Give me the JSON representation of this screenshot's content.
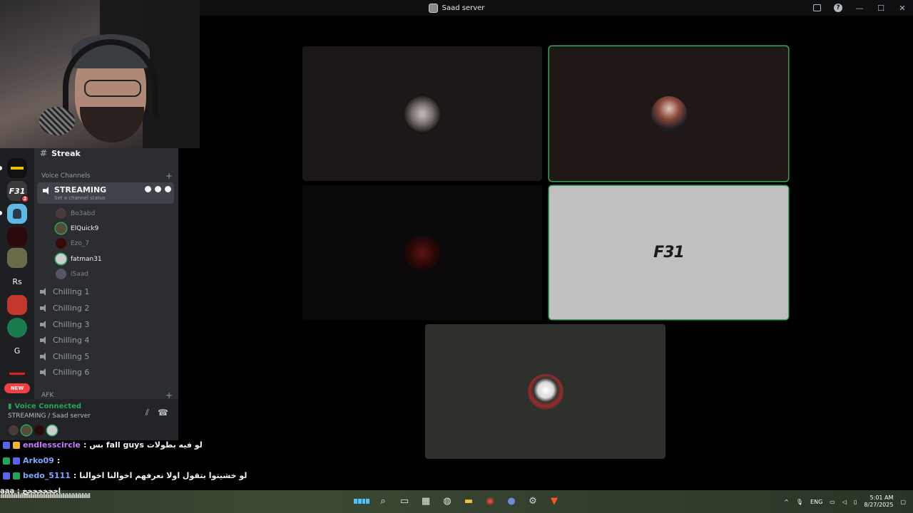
{
  "window": {
    "title": "Saad server"
  },
  "sidebar": {
    "text_channel": "Streak",
    "voice_category": "Voice Channels",
    "active_channel": {
      "name": "STREAMING",
      "status": "Set a channel status"
    },
    "users": [
      "Bo3abd",
      "ElQuick9",
      "Ezo_7",
      "fatman31",
      "iSaad"
    ],
    "channels": [
      "Chilling 1",
      "Chilling 2",
      "Chilling 3",
      "Chilling 4",
      "Chilling 5",
      "Chilling 6"
    ],
    "afk_category": "AFK"
  },
  "servers": {
    "f31_label": "F31",
    "f31_badge": "1",
    "rs_label": "Rs",
    "g_label": "G",
    "new_badge": "NEW"
  },
  "voice_panel": {
    "status": "Voice Connected",
    "location": "STREAMING / Saad server"
  },
  "stage": {
    "tile4_label": "F31"
  },
  "chat": [
    {
      "name": "endlesscircle",
      "sep": ":",
      "text": "بس fall guys لو فيه بطولات"
    },
    {
      "name": "Arko09",
      "sep": ":",
      "text": ""
    },
    {
      "name": "bedo_5111",
      "sep": ":",
      "text": "لو خشيتوا بتقول اولا نعرفهم اخوالنا اخوالنا"
    },
    {
      "name": "",
      "sep": "",
      "text": "aaa : اخخخخخخخ"
    }
  ],
  "taskbar": {
    "lang": "ENG",
    "time": "5:01 AM",
    "date": "8/27/2025"
  },
  "colors": {
    "speaking": "#3ba55c",
    "voice_connected": "#23a55a",
    "badge": "#f23f43"
  }
}
